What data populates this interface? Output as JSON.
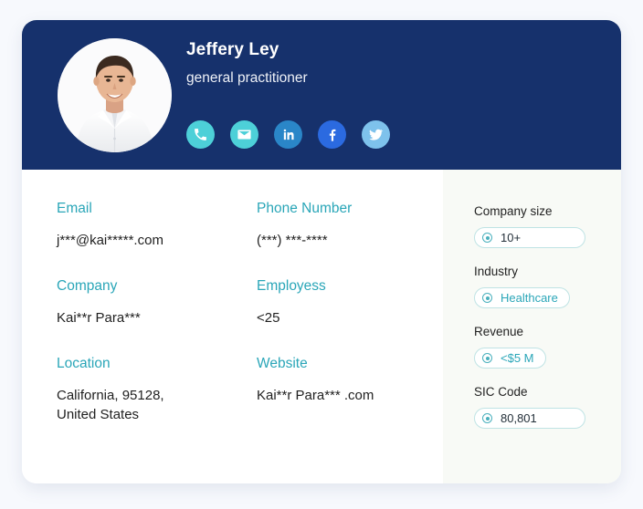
{
  "theme": {
    "page_background": "#f7f9fd",
    "card_background": "#ffffff",
    "header_navy": "#16316c",
    "label_teal": "#2aa6b8",
    "side_panel_background": "#f8faf6",
    "pill_border": "#bfe3e4"
  },
  "header": {
    "name": "Jeffery Ley",
    "title": "general practitioner",
    "avatar_alt": "portrait photo of smiling man in white shirt",
    "social": [
      {
        "name": "phone-icon",
        "label": "Phone",
        "color": "#4dd0d8"
      },
      {
        "name": "email-icon",
        "label": "Email",
        "color": "#4dd0d8"
      },
      {
        "name": "linkedin-icon",
        "label": "LinkedIn",
        "color": "#2a86c8"
      },
      {
        "name": "facebook-icon",
        "label": "Facebook",
        "color": "#2b6ae0"
      },
      {
        "name": "twitter-icon",
        "label": "Twitter",
        "color": "#7ec2ec"
      }
    ]
  },
  "details": [
    {
      "label": "Email",
      "value": "j***@kai*****.com"
    },
    {
      "label": "Phone Number",
      "value": "(***) ***-****"
    },
    {
      "label": "Company",
      "value": "Kai**r Para***"
    },
    {
      "label": "Employess",
      "value": "<25"
    },
    {
      "label": "Location",
      "value": "California, 95128,\nUnited States"
    },
    {
      "label": "Website",
      "value": "Kai**r Para*** .com"
    }
  ],
  "side_panel": [
    {
      "label": "Company size",
      "value": "10+",
      "value_style": "dark",
      "pill_style": "wide"
    },
    {
      "label": "Industry",
      "value": "Healthcare",
      "value_style": "teal",
      "pill_style": "auto"
    },
    {
      "label": "Revenue",
      "value": "<$5 M",
      "value_style": "teal",
      "pill_style": "auto"
    },
    {
      "label": "SIC Code",
      "value": "80,801",
      "value_style": "dark",
      "pill_style": "wide"
    }
  ]
}
